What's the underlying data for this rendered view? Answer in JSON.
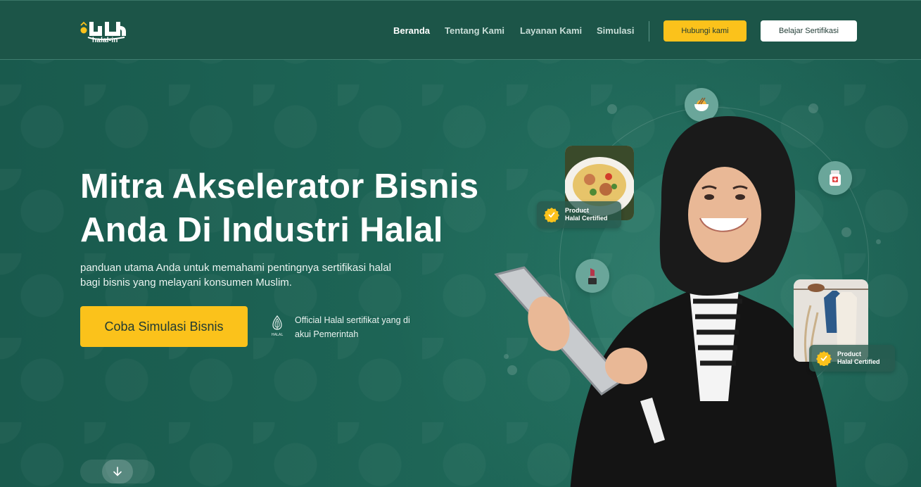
{
  "brand": {
    "logo_text": "halal-in"
  },
  "nav": {
    "items": [
      {
        "label": "Beranda",
        "active": true
      },
      {
        "label": "Tentang Kami",
        "active": false
      },
      {
        "label": "Layanan Kami",
        "active": false
      },
      {
        "label": "Simulasi",
        "active": false
      }
    ],
    "contact_label": "Hubungi kami",
    "learn_label": "Belajar Sertifikasi"
  },
  "hero": {
    "title_line1": "Mitra Akselerator Bisnis",
    "title_line2": "Anda Di Industri Halal",
    "subtitle_line1": "panduan utama Anda untuk memahami pentingnya sertifikasi halal",
    "subtitle_line2": "bagi bisnis yang melayani konsumen Muslim.",
    "cta_label": "Coba Simulasi Bisnis",
    "official_line1": "Official Halal sertifikat yang di",
    "official_line2": "akui Pemerintah",
    "official_logo_text": "HALAL"
  },
  "badges": {
    "food": {
      "line1": "Product",
      "line2": "Halal Certified"
    },
    "clothing": {
      "line1": "Product",
      "line2": "Halal Certified"
    }
  },
  "icons": {
    "bowl": "noodle-bowl-icon",
    "medicine": "medicine-bottle-icon",
    "cosmetic": "lipstick-icon",
    "scroll": "arrow-down-icon",
    "certified": "certified-check-icon"
  },
  "colors": {
    "background": "#1d5f52",
    "header": "#1c5548",
    "accent_yellow": "#fbc21b",
    "button_text": "#1f3a33"
  }
}
